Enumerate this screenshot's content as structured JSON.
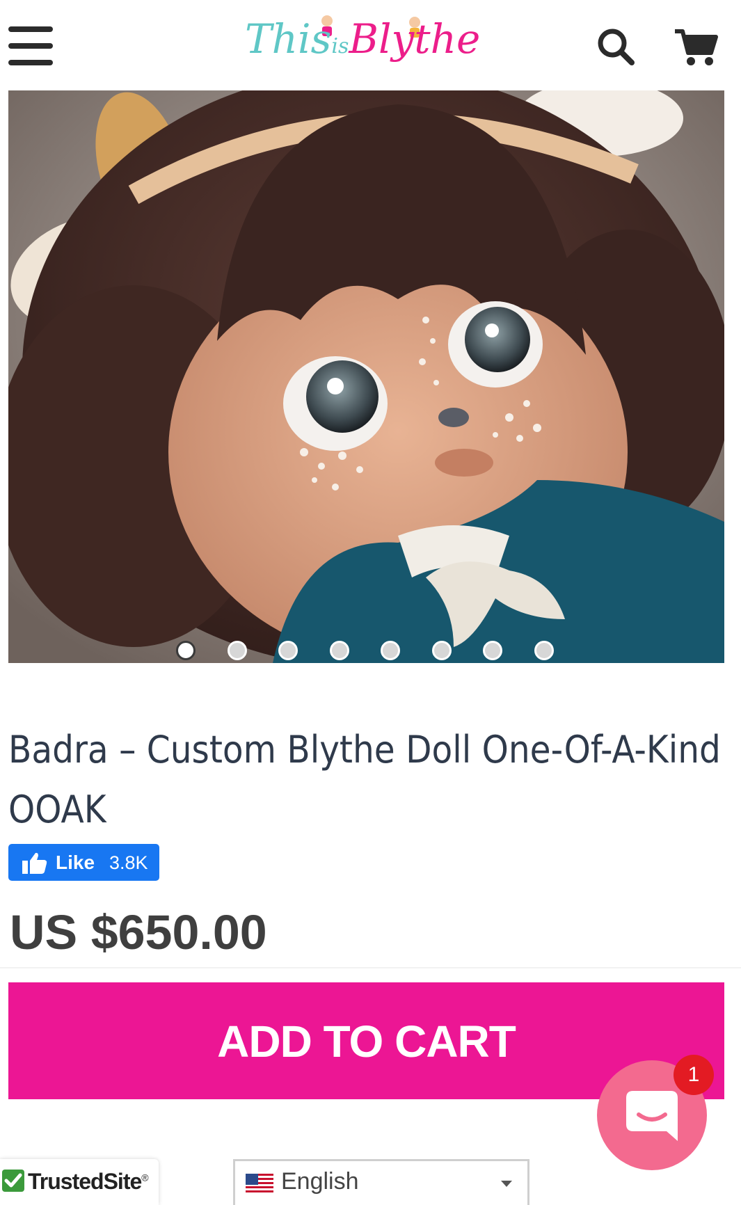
{
  "header": {
    "logo": {
      "part1": "This",
      "part2": "is",
      "part3": "Blythe"
    }
  },
  "gallery": {
    "slide_count": 8,
    "active_index": 0
  },
  "product": {
    "title": "Badra – Custom Blythe Doll One-Of-A-Kind OOAK",
    "like_label": "Like",
    "like_count": "3.8K",
    "price": "US $650.00",
    "add_to_cart": "ADD TO CART"
  },
  "chat": {
    "badge_count": "1"
  },
  "footer": {
    "trusted_label": "TrustedSite",
    "trusted_mark": "®",
    "language": "English"
  },
  "colors": {
    "accent": "#ec1694",
    "facebook": "#1877f2",
    "chat": "#f36a8f",
    "badge": "#e31b23",
    "title_text": "#2f3a4b"
  },
  "icons": [
    "menu-icon",
    "search-icon",
    "cart-icon",
    "like-thumb-icon",
    "chat-icon",
    "check-icon",
    "us-flag-icon",
    "caret-down-icon"
  ]
}
